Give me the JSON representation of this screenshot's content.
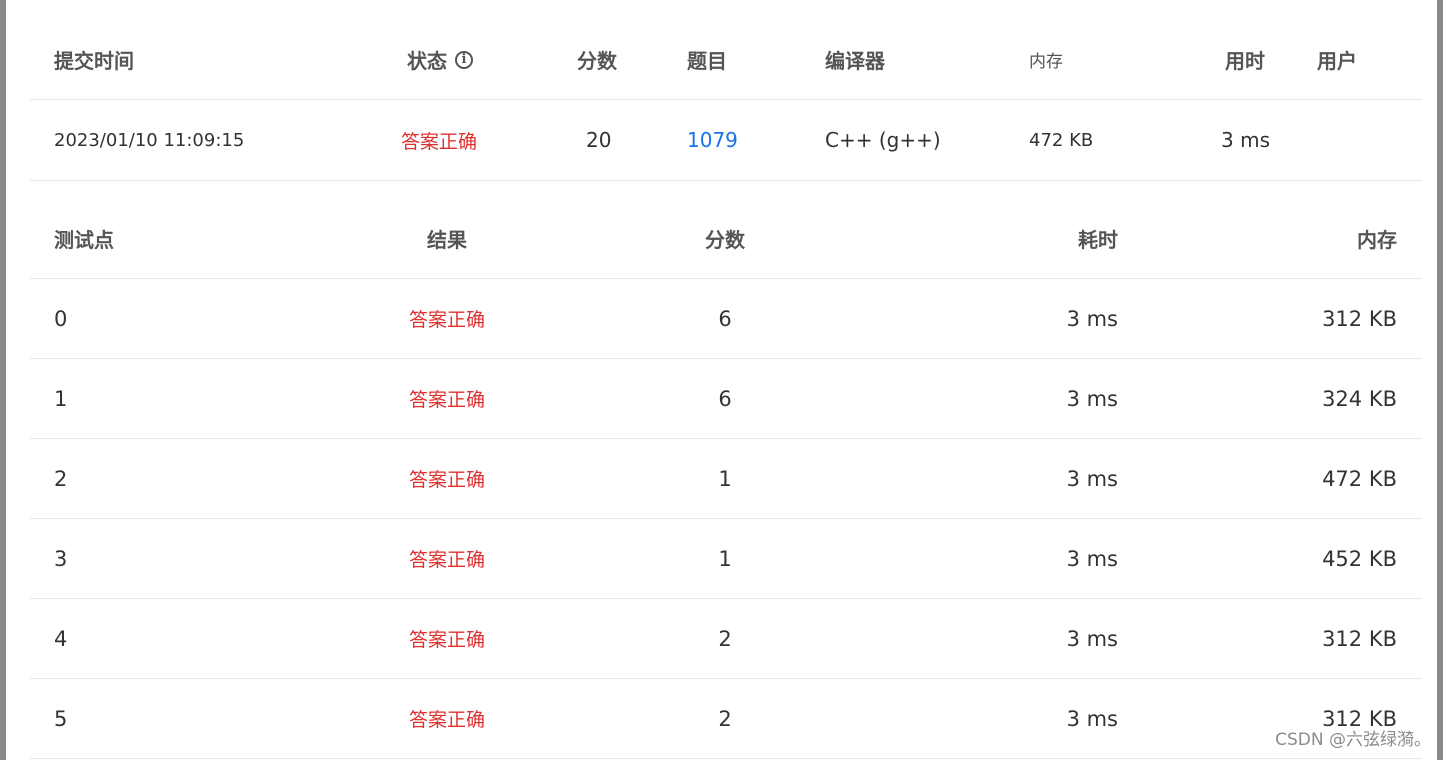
{
  "submission": {
    "headers": {
      "time": "提交时间",
      "status": "状态",
      "score": "分数",
      "problem": "题目",
      "compiler": "编译器",
      "memory": "内存",
      "duration": "用时",
      "user": "用户"
    },
    "row": {
      "time": "2023/01/10 11:09:15",
      "status": "答案正确",
      "score": "20",
      "problem": "1079",
      "compiler": "C++ (g++)",
      "memory": "472 KB",
      "duration": "3 ms",
      "user": ""
    }
  },
  "testcases": {
    "headers": {
      "case": "测试点",
      "result": "结果",
      "score": "分数",
      "time": "耗时",
      "memory": "内存"
    },
    "rows": [
      {
        "case": "0",
        "result": "答案正确",
        "score": "6",
        "time": "3 ms",
        "memory": "312 KB"
      },
      {
        "case": "1",
        "result": "答案正确",
        "score": "6",
        "time": "3 ms",
        "memory": "324 KB"
      },
      {
        "case": "2",
        "result": "答案正确",
        "score": "1",
        "time": "3 ms",
        "memory": "472 KB"
      },
      {
        "case": "3",
        "result": "答案正确",
        "score": "1",
        "time": "3 ms",
        "memory": "452 KB"
      },
      {
        "case": "4",
        "result": "答案正确",
        "score": "2",
        "time": "3 ms",
        "memory": "312 KB"
      },
      {
        "case": "5",
        "result": "答案正确",
        "score": "2",
        "time": "3 ms",
        "memory": "312 KB"
      }
    ]
  },
  "watermark": "CSDN @六弦绿漪。",
  "colors": {
    "accepted": "#e0302f",
    "link": "#1a73e8"
  }
}
